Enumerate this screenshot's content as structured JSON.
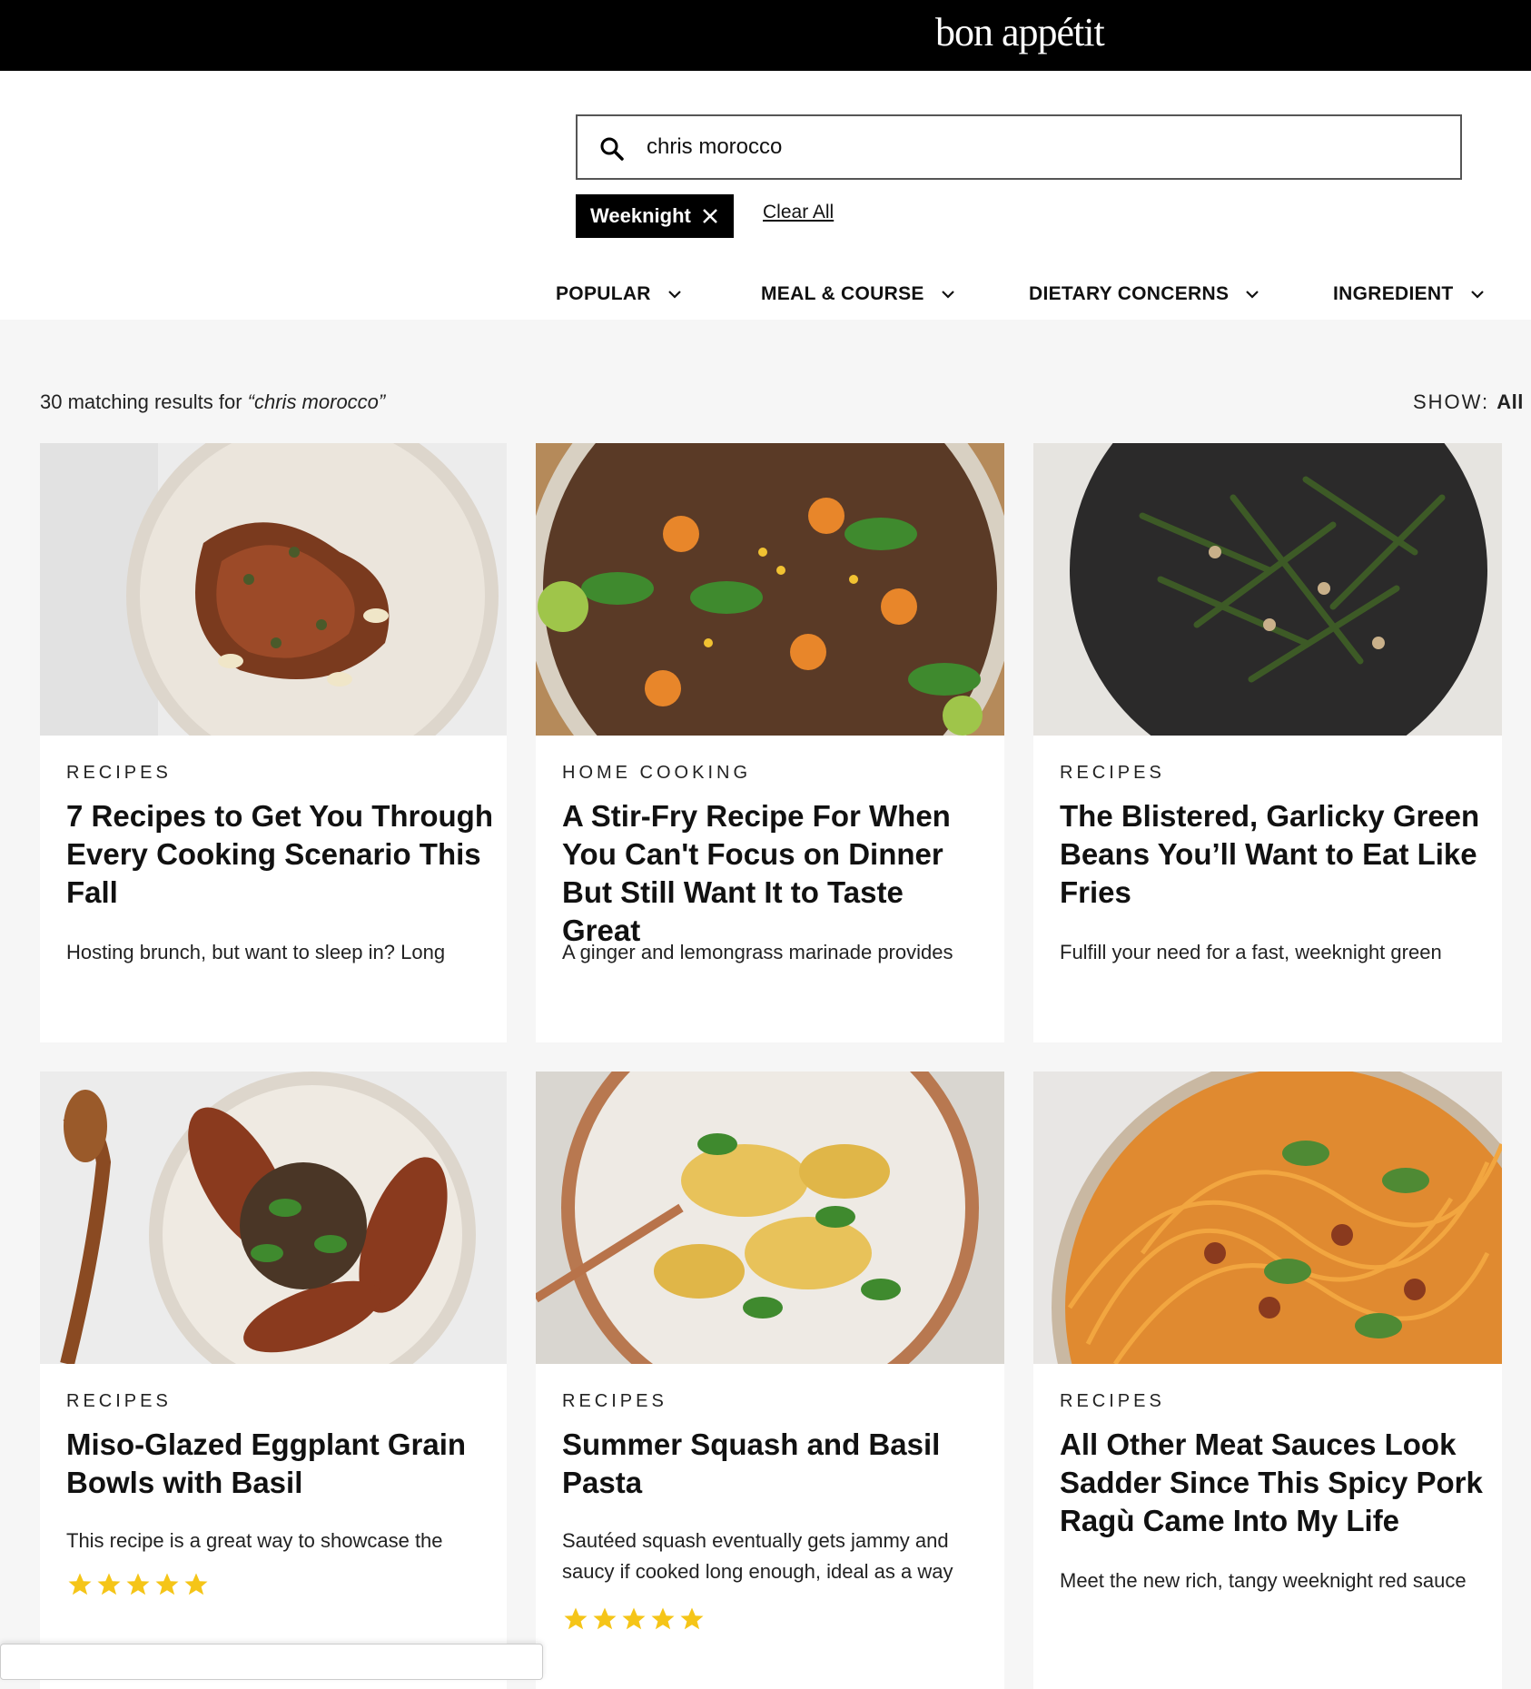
{
  "header": {
    "logo": "bon appétit"
  },
  "search": {
    "value": "chris morocco",
    "placeholder": ""
  },
  "active_filters": {
    "chip": "Weeknight",
    "clear_all": "Clear All"
  },
  "filters": [
    {
      "label": "POPULAR"
    },
    {
      "label": "MEAL & COURSE"
    },
    {
      "label": "DIETARY CONCERNS"
    },
    {
      "label": "INGREDIENT"
    }
  ],
  "results": {
    "count_text": "30 matching results for ",
    "query": "“chris morocco”",
    "show_label": "SHOW: ",
    "show_value": "All"
  },
  "cards": [
    {
      "category": "RECIPES",
      "title": "7 Recipes to Get You Through Every Cooking Scenario This Fall",
      "description": "Hosting brunch, but want to sleep in? Long",
      "rating": null
    },
    {
      "category": "HOME COOKING",
      "title": "A Stir-Fry Recipe For When You Can't Focus on Dinner But Still Want It to Taste Great",
      "description": "A ginger and lemongrass marinade provides",
      "rating": null
    },
    {
      "category": "RECIPES",
      "title": "The Blistered, Garlicky Green Beans You’ll Want to Eat Like Fries",
      "description": "Fulfill your need for a fast, weeknight green",
      "rating": null
    },
    {
      "category": "RECIPES",
      "title": "Miso-Glazed Eggplant Grain Bowls with Basil",
      "description": "This recipe is a great way to showcase the",
      "rating": 5
    },
    {
      "category": "RECIPES",
      "title": "Summer Squash and Basil Pasta",
      "description": "Sautéed squash eventually gets jammy and saucy if cooked long enough, ideal as a way",
      "rating": 5
    },
    {
      "category": "RECIPES",
      "title": "All Other Meat Sauces Look Sadder Since This Spicy Pork Ragù Came Into My Life",
      "description": "Meet the new rich, tangy weeknight red sauce",
      "rating": null
    }
  ],
  "colors": {
    "star": "#f5c518",
    "topbar": "#000000"
  }
}
